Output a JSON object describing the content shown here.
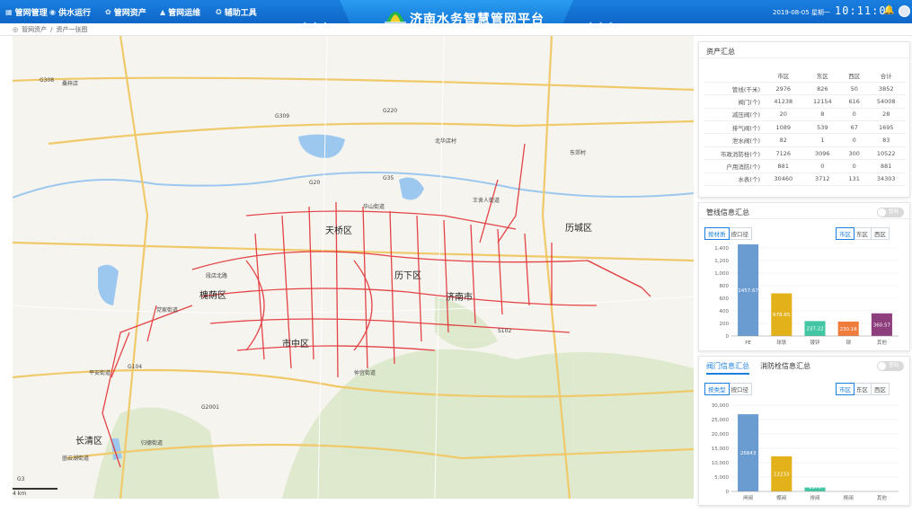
{
  "header": {
    "nav": [
      {
        "label": "管网管理",
        "icon": "grid-icon"
      },
      {
        "label": "供水运行",
        "icon": "gauge-icon"
      },
      {
        "label": "管网资产",
        "icon": "gear-icon"
      },
      {
        "label": "管网运维",
        "icon": "warning-icon"
      },
      {
        "label": "辅助工具",
        "icon": "tool-icon"
      }
    ],
    "title": "济南水务智慧管网平台",
    "date": "2019-08-05 星期一",
    "time": "10:11:06"
  },
  "breadcrumb": {
    "items": [
      "管网资产",
      "资产一张图"
    ]
  },
  "map": {
    "districts": [
      "槐荫区",
      "天桥区",
      "历下区",
      "市中区",
      "历城区",
      "长清区",
      "济南市"
    ],
    "roads": [
      "G308",
      "G220",
      "G309",
      "G35",
      "G104",
      "G2001",
      "G3",
      "S102",
      "G20"
    ],
    "places": [
      "桑梓店",
      "北华店村",
      "东郊村",
      "王舍人街道",
      "华山街道",
      "段店北路",
      "党家街道",
      "平安街道",
      "仲宫街道",
      "归德街道",
      "崮云湖街道"
    ],
    "scale_label": "4 km"
  },
  "asset_panel": {
    "title": "资产汇总",
    "columns": [
      "",
      "市区",
      "东区",
      "西区",
      "合计"
    ],
    "rows": [
      [
        "管线(千米)",
        "2976",
        "826",
        "50",
        "3852"
      ],
      [
        "阀门(个)",
        "41238",
        "12154",
        "616",
        "54008"
      ],
      [
        "减压阀(个)",
        "20",
        "8",
        "0",
        "28"
      ],
      [
        "排气阀(个)",
        "1089",
        "539",
        "67",
        "1695"
      ],
      [
        "泄水阀(个)",
        "82",
        "1",
        "0",
        "83"
      ],
      [
        "市政消防栓(个)",
        "7126",
        "3096",
        "300",
        "10522"
      ],
      [
        "户用消防(个)",
        "881",
        "0",
        "0",
        "881"
      ],
      [
        "水表(个)",
        "30460",
        "3712",
        "131",
        "34303"
      ]
    ]
  },
  "pipe_panel": {
    "title": "管线信息汇总",
    "toggle": "管网",
    "seg_left": [
      "按材质",
      "按口径"
    ],
    "seg_right": [
      "市区",
      "东区",
      "西区"
    ],
    "chart_data": {
      "type": "bar",
      "categories": [
        "PE",
        "球铁",
        "镀锌",
        "钢",
        "其他"
      ],
      "values": [
        1457.67,
        678.65,
        237.22,
        230.16,
        360.57
      ],
      "value_labels": [
        "1457.67",
        "678.65",
        "237.22",
        "230.16",
        "360.57"
      ],
      "yticks": [
        "0",
        "200",
        "400",
        "600",
        "800",
        "1,000",
        "1,200",
        "1,400"
      ],
      "ylim": [
        0,
        1400
      ],
      "colors": [
        "#6a9bd1",
        "#e3b21b",
        "#43c6a3",
        "#f07c3c",
        "#8e3d7d"
      ]
    }
  },
  "valve_panel": {
    "tabs": [
      "阀门信息汇总",
      "消防栓信息汇总"
    ],
    "toggle": "管网",
    "seg_left": [
      "按类型",
      "按口径"
    ],
    "seg_right": [
      "市区",
      "东区",
      "西区"
    ],
    "chart_data": {
      "type": "bar",
      "categories": [
        "闸阀",
        "蝶阀",
        "排阀",
        "楔阀",
        "其他"
      ],
      "values": [
        26843,
        12233,
        1370,
        0,
        0
      ],
      "value_labels": [
        "26843",
        "12233",
        "1370",
        "",
        ""
      ],
      "yticks": [
        "0",
        "5,000",
        "10,000",
        "15,000",
        "20,000",
        "25,000",
        "30,000"
      ],
      "ylim": [
        0,
        30000
      ],
      "colors": [
        "#6a9bd1",
        "#e3b21b",
        "#43c6a3",
        "#f07c3c",
        "#8e3d7d"
      ]
    }
  }
}
